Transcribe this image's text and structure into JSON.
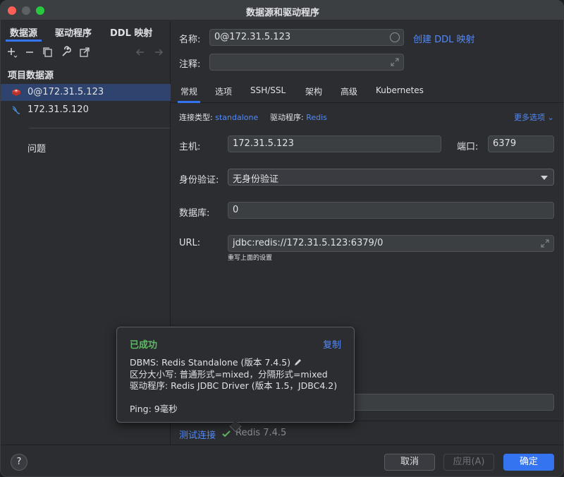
{
  "window": {
    "title": "数据源和驱动程序"
  },
  "left": {
    "tabs": [
      "数据源",
      "驱动程序",
      "DDL 映射"
    ],
    "section_label": "项目数据源",
    "datasources": [
      {
        "label": "0@172.31.5.123",
        "icon": "redis-icon",
        "selected": true
      },
      {
        "label": "172.31.5.120",
        "icon": "database-icon",
        "selected": false
      }
    ],
    "problems_label": "问题"
  },
  "right": {
    "name_label": "名称:",
    "name_value": "0@172.31.5.123",
    "create_ddl_link": "创建 DDL 映射",
    "comment_label": "注释:",
    "comment_value": "",
    "tabs": [
      "常规",
      "选项",
      "SSH/SSL",
      "架构",
      "高级",
      "Kubernetes"
    ],
    "conn_type_label": "连接类型:",
    "conn_type_value": "standalone",
    "driver_label": "驱动程序:",
    "driver_value": "Redis",
    "more_options": "更多选项",
    "host_label": "主机:",
    "host_value": "172.31.5.123",
    "port_label": "端口:",
    "port_value": "6379",
    "auth_label": "身份验证:",
    "auth_value": "无身份验证",
    "db_label": "数据库:",
    "db_value": "0",
    "url_label": "URL:",
    "url_value": "jdbc:redis://172.31.5.123:6379/0",
    "url_hint": "重写上面的设置",
    "test_connection": "测试连接",
    "test_result": "Redis 7.4.5"
  },
  "popup": {
    "status": "已成功",
    "copy": "复制",
    "dbms": "DBMS: Redis Standalone (版本 7.4.5)",
    "case": "区分大小写: 普通形式=mixed，分隔形式=mixed",
    "driver": "驱动程序: Redis JDBC Driver (版本 1.5，JDBC4.2)",
    "ping": "Ping: 9毫秒"
  },
  "footer": {
    "help": "?",
    "cancel": "取消",
    "apply": "应用(A)",
    "ok": "确定"
  },
  "colors": {
    "accent": "#3574f0",
    "link": "#548af7",
    "success": "#5fb865",
    "selection": "#2e436e"
  }
}
